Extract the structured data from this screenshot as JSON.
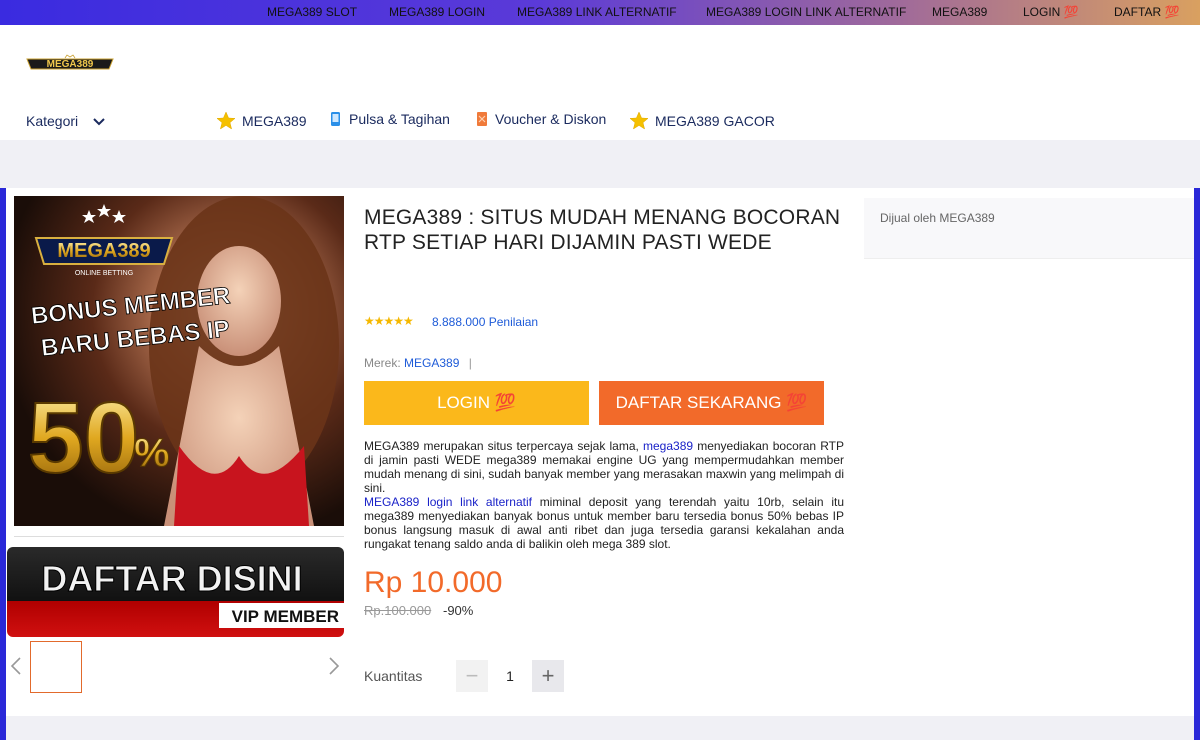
{
  "topnav": [
    "MEGA389 SLOT",
    "MEGA389 LOGIN",
    "MEGA389 LINK ALTERNATIF",
    "MEGA389 LOGIN LINK ALTERNATIF",
    "MEGA389",
    "LOGIN 💯",
    "DAFTAR 💯"
  ],
  "header": {
    "logo_text": "MEGA389",
    "logo_sub": "ONLINE BETTING",
    "kategori": "Kategori",
    "nav": [
      {
        "label": "MEGA389",
        "icon": "star-icon"
      },
      {
        "label": "Pulsa & Tagihan",
        "icon": "phone-icon"
      },
      {
        "label": "Voucher & Diskon",
        "icon": "voucher-icon"
      },
      {
        "label": "MEGA389 GACOR",
        "icon": "star-icon"
      }
    ]
  },
  "gallery": {
    "hero": {
      "logo": "MEGA389",
      "logo_sub": "ONLINE BETTING",
      "bonus_line1": "BONUS MEMBER",
      "bonus_line2": "BARU BEBAS IP",
      "percent": "50",
      "percent_sign": "%"
    },
    "banner": {
      "main": "DAFTAR DISINI",
      "sub": "VIP MEMBER"
    }
  },
  "product": {
    "title": "MEGA389 : SITUS MUDAH MENANG BOCORAN RTP SETIAP HARI DIJAMIN PASTI WEDE",
    "stars": "★★★★★",
    "rating_count": "8.888.000 Penilaian",
    "brand_label": "Merek:",
    "brand_value": "MEGA389",
    "brand_sep": "|",
    "login_button": "LOGIN 💯",
    "daftar_button": "DAFTAR SEKARANG 💯",
    "desc_p1_a": "MEGA389 merupakan situs terpercaya sejak lama, ",
    "desc_p1_link": "mega389",
    "desc_p1_b": " menyediakan bocoran RTP di jamin pasti WEDE mega389 memakai engine UG yang mempermudahkan member mudah menang di sini, sudah banyak member yang merasakan maxwin yang melimpah di sini.",
    "desc_p2_link": "MEGA389 login link alternatif",
    "desc_p2_b": " miminal deposit yang terendah yaitu 10rb, selain itu mega389 menyediakan banyak bonus untuk member baru tersedia bonus 50% bebas IP bonus langsung masuk di awal anti ribet dan juga tersedia garansi kekalahan anda rungakat tenang saldo anda di balikin oleh mega 389 slot.",
    "price": "Rp 10.000",
    "old_price": "Rp.100.000",
    "discount": "-90%",
    "qty_label": "Kuantitas",
    "qty_minus": "−",
    "qty_value": "1",
    "qty_plus": "+"
  },
  "seller": {
    "text": "Dijual oleh MEGA389"
  },
  "colors": {
    "accent_orange": "#f26a2a",
    "accent_yellow": "#fbb81b",
    "link_blue": "#1e5bd8",
    "frame_blue": "#2a28d8"
  }
}
